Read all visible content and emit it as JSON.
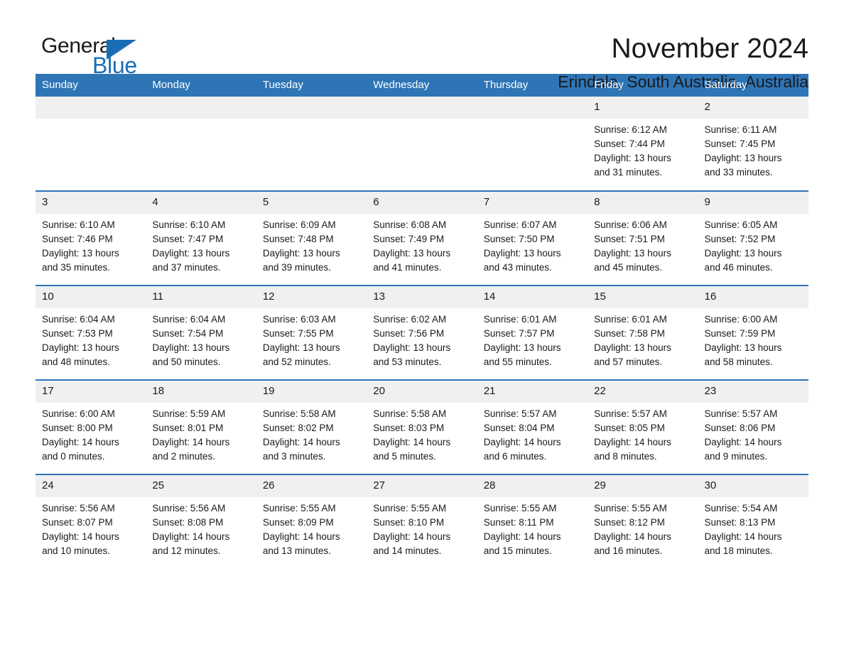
{
  "brand": {
    "name_part1": "General",
    "name_part2": "Blue",
    "triangle_color": "#1a6db5"
  },
  "header": {
    "title": "November 2024",
    "subtitle": "Erindale, South Australia, Australia",
    "accent_color": "#2e75b6",
    "daynum_background": "#f0f0f0"
  },
  "weekdays": [
    "Sunday",
    "Monday",
    "Tuesday",
    "Wednesday",
    "Thursday",
    "Friday",
    "Saturday"
  ],
  "weeks": [
    [
      {
        "day": "",
        "sunrise": "",
        "sunset": "",
        "daylight1": "",
        "daylight2": ""
      },
      {
        "day": "",
        "sunrise": "",
        "sunset": "",
        "daylight1": "",
        "daylight2": ""
      },
      {
        "day": "",
        "sunrise": "",
        "sunset": "",
        "daylight1": "",
        "daylight2": ""
      },
      {
        "day": "",
        "sunrise": "",
        "sunset": "",
        "daylight1": "",
        "daylight2": ""
      },
      {
        "day": "",
        "sunrise": "",
        "sunset": "",
        "daylight1": "",
        "daylight2": ""
      },
      {
        "day": "1",
        "sunrise": "Sunrise: 6:12 AM",
        "sunset": "Sunset: 7:44 PM",
        "daylight1": "Daylight: 13 hours",
        "daylight2": "and 31 minutes."
      },
      {
        "day": "2",
        "sunrise": "Sunrise: 6:11 AM",
        "sunset": "Sunset: 7:45 PM",
        "daylight1": "Daylight: 13 hours",
        "daylight2": "and 33 minutes."
      }
    ],
    [
      {
        "day": "3",
        "sunrise": "Sunrise: 6:10 AM",
        "sunset": "Sunset: 7:46 PM",
        "daylight1": "Daylight: 13 hours",
        "daylight2": "and 35 minutes."
      },
      {
        "day": "4",
        "sunrise": "Sunrise: 6:10 AM",
        "sunset": "Sunset: 7:47 PM",
        "daylight1": "Daylight: 13 hours",
        "daylight2": "and 37 minutes."
      },
      {
        "day": "5",
        "sunrise": "Sunrise: 6:09 AM",
        "sunset": "Sunset: 7:48 PM",
        "daylight1": "Daylight: 13 hours",
        "daylight2": "and 39 minutes."
      },
      {
        "day": "6",
        "sunrise": "Sunrise: 6:08 AM",
        "sunset": "Sunset: 7:49 PM",
        "daylight1": "Daylight: 13 hours",
        "daylight2": "and 41 minutes."
      },
      {
        "day": "7",
        "sunrise": "Sunrise: 6:07 AM",
        "sunset": "Sunset: 7:50 PM",
        "daylight1": "Daylight: 13 hours",
        "daylight2": "and 43 minutes."
      },
      {
        "day": "8",
        "sunrise": "Sunrise: 6:06 AM",
        "sunset": "Sunset: 7:51 PM",
        "daylight1": "Daylight: 13 hours",
        "daylight2": "and 45 minutes."
      },
      {
        "day": "9",
        "sunrise": "Sunrise: 6:05 AM",
        "sunset": "Sunset: 7:52 PM",
        "daylight1": "Daylight: 13 hours",
        "daylight2": "and 46 minutes."
      }
    ],
    [
      {
        "day": "10",
        "sunrise": "Sunrise: 6:04 AM",
        "sunset": "Sunset: 7:53 PM",
        "daylight1": "Daylight: 13 hours",
        "daylight2": "and 48 minutes."
      },
      {
        "day": "11",
        "sunrise": "Sunrise: 6:04 AM",
        "sunset": "Sunset: 7:54 PM",
        "daylight1": "Daylight: 13 hours",
        "daylight2": "and 50 minutes."
      },
      {
        "day": "12",
        "sunrise": "Sunrise: 6:03 AM",
        "sunset": "Sunset: 7:55 PM",
        "daylight1": "Daylight: 13 hours",
        "daylight2": "and 52 minutes."
      },
      {
        "day": "13",
        "sunrise": "Sunrise: 6:02 AM",
        "sunset": "Sunset: 7:56 PM",
        "daylight1": "Daylight: 13 hours",
        "daylight2": "and 53 minutes."
      },
      {
        "day": "14",
        "sunrise": "Sunrise: 6:01 AM",
        "sunset": "Sunset: 7:57 PM",
        "daylight1": "Daylight: 13 hours",
        "daylight2": "and 55 minutes."
      },
      {
        "day": "15",
        "sunrise": "Sunrise: 6:01 AM",
        "sunset": "Sunset: 7:58 PM",
        "daylight1": "Daylight: 13 hours",
        "daylight2": "and 57 minutes."
      },
      {
        "day": "16",
        "sunrise": "Sunrise: 6:00 AM",
        "sunset": "Sunset: 7:59 PM",
        "daylight1": "Daylight: 13 hours",
        "daylight2": "and 58 minutes."
      }
    ],
    [
      {
        "day": "17",
        "sunrise": "Sunrise: 6:00 AM",
        "sunset": "Sunset: 8:00 PM",
        "daylight1": "Daylight: 14 hours",
        "daylight2": "and 0 minutes."
      },
      {
        "day": "18",
        "sunrise": "Sunrise: 5:59 AM",
        "sunset": "Sunset: 8:01 PM",
        "daylight1": "Daylight: 14 hours",
        "daylight2": "and 2 minutes."
      },
      {
        "day": "19",
        "sunrise": "Sunrise: 5:58 AM",
        "sunset": "Sunset: 8:02 PM",
        "daylight1": "Daylight: 14 hours",
        "daylight2": "and 3 minutes."
      },
      {
        "day": "20",
        "sunrise": "Sunrise: 5:58 AM",
        "sunset": "Sunset: 8:03 PM",
        "daylight1": "Daylight: 14 hours",
        "daylight2": "and 5 minutes."
      },
      {
        "day": "21",
        "sunrise": "Sunrise: 5:57 AM",
        "sunset": "Sunset: 8:04 PM",
        "daylight1": "Daylight: 14 hours",
        "daylight2": "and 6 minutes."
      },
      {
        "day": "22",
        "sunrise": "Sunrise: 5:57 AM",
        "sunset": "Sunset: 8:05 PM",
        "daylight1": "Daylight: 14 hours",
        "daylight2": "and 8 minutes."
      },
      {
        "day": "23",
        "sunrise": "Sunrise: 5:57 AM",
        "sunset": "Sunset: 8:06 PM",
        "daylight1": "Daylight: 14 hours",
        "daylight2": "and 9 minutes."
      }
    ],
    [
      {
        "day": "24",
        "sunrise": "Sunrise: 5:56 AM",
        "sunset": "Sunset: 8:07 PM",
        "daylight1": "Daylight: 14 hours",
        "daylight2": "and 10 minutes."
      },
      {
        "day": "25",
        "sunrise": "Sunrise: 5:56 AM",
        "sunset": "Sunset: 8:08 PM",
        "daylight1": "Daylight: 14 hours",
        "daylight2": "and 12 minutes."
      },
      {
        "day": "26",
        "sunrise": "Sunrise: 5:55 AM",
        "sunset": "Sunset: 8:09 PM",
        "daylight1": "Daylight: 14 hours",
        "daylight2": "and 13 minutes."
      },
      {
        "day": "27",
        "sunrise": "Sunrise: 5:55 AM",
        "sunset": "Sunset: 8:10 PM",
        "daylight1": "Daylight: 14 hours",
        "daylight2": "and 14 minutes."
      },
      {
        "day": "28",
        "sunrise": "Sunrise: 5:55 AM",
        "sunset": "Sunset: 8:11 PM",
        "daylight1": "Daylight: 14 hours",
        "daylight2": "and 15 minutes."
      },
      {
        "day": "29",
        "sunrise": "Sunrise: 5:55 AM",
        "sunset": "Sunset: 8:12 PM",
        "daylight1": "Daylight: 14 hours",
        "daylight2": "and 16 minutes."
      },
      {
        "day": "30",
        "sunrise": "Sunrise: 5:54 AM",
        "sunset": "Sunset: 8:13 PM",
        "daylight1": "Daylight: 14 hours",
        "daylight2": "and 18 minutes."
      }
    ]
  ]
}
